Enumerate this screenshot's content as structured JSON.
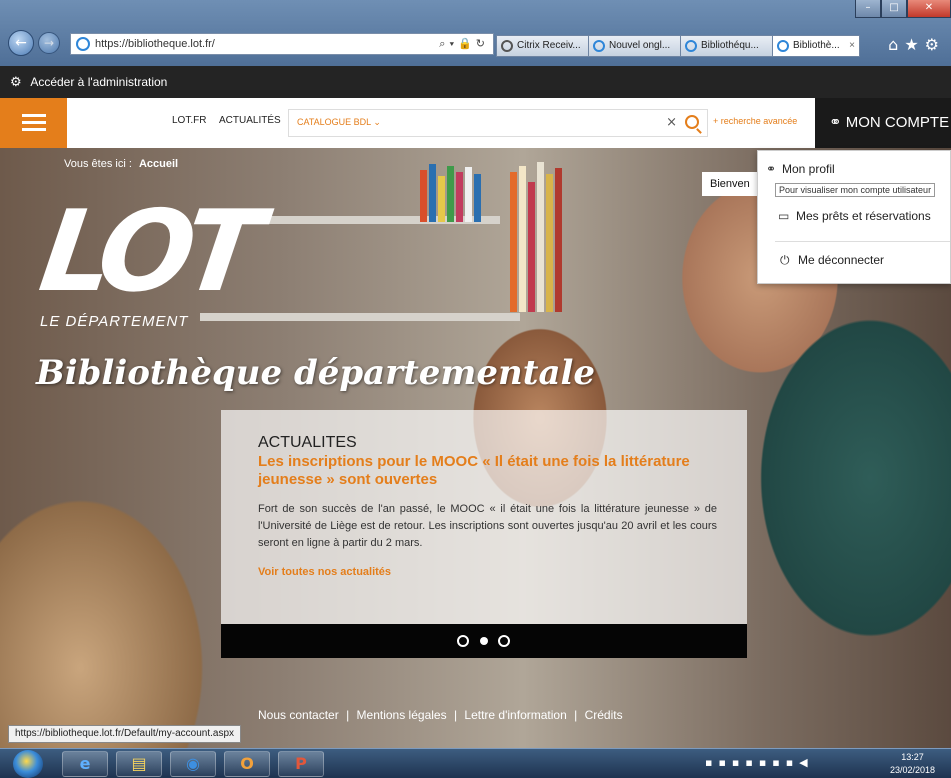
{
  "browser": {
    "url": "https://bibliotheque.lot.fr/",
    "tabs": [
      {
        "label": "Citrix Receiv..."
      },
      {
        "label": "Nouvel ongl..."
      },
      {
        "label": "Bibliothéqu..."
      },
      {
        "label": "Bibliothè..."
      }
    ],
    "tab_close": "×"
  },
  "adminbar": {
    "label": "Accéder à l'administration"
  },
  "header": {
    "links": [
      "LOT.FR",
      "ACTUALITÉS"
    ],
    "search_scope": "CATALOGUE BDL ⌄",
    "clear": "×",
    "advanced": "+ recherche avancée",
    "account_label": "MON COMPTE"
  },
  "hero": {
    "breadcrumb_prefix": "Vous êtes ici :",
    "breadcrumb_current": "Accueil",
    "logo_main": "LOT",
    "logo_sub": "LE DÉPARTEMENT",
    "logo_title": "Bibliothèque départementale",
    "welcome": "Bienven"
  },
  "news": {
    "kicker": "ACTUALITES",
    "title": "Les inscriptions pour le MOOC « Il était une fois la littérature jeunesse » sont ouvertes",
    "body": "Fort de son succès de l'an passé, le MOOC « il était une fois la littérature jeunesse » de l'Université de Liège est de retour. Les inscriptions sont ouvertes jusqu'au 20 avril et les cours seront en ligne à partir du 2 mars.",
    "more": "Voir toutes nos actualités",
    "slides": 3,
    "active_slide": 2
  },
  "footer": {
    "links": [
      "Nous contacter",
      "Mentions légales",
      "Lettre d'information",
      "Crédits"
    ],
    "separator": "|"
  },
  "dropdown": {
    "profile": "Mon profil",
    "tooltip": "Pour visualiser mon compte utilisateur",
    "loans": "Mes prêts et réservations",
    "logout": "Me déconnecter"
  },
  "statusbar": {
    "url": "https://bibliotheque.lot.fr/Default/my-account.aspx"
  },
  "taskbar": {
    "time": "13:27",
    "date": "23/02/2018"
  },
  "colors": {
    "accent": "#e47e1b",
    "dark": "#1a1a1a"
  }
}
